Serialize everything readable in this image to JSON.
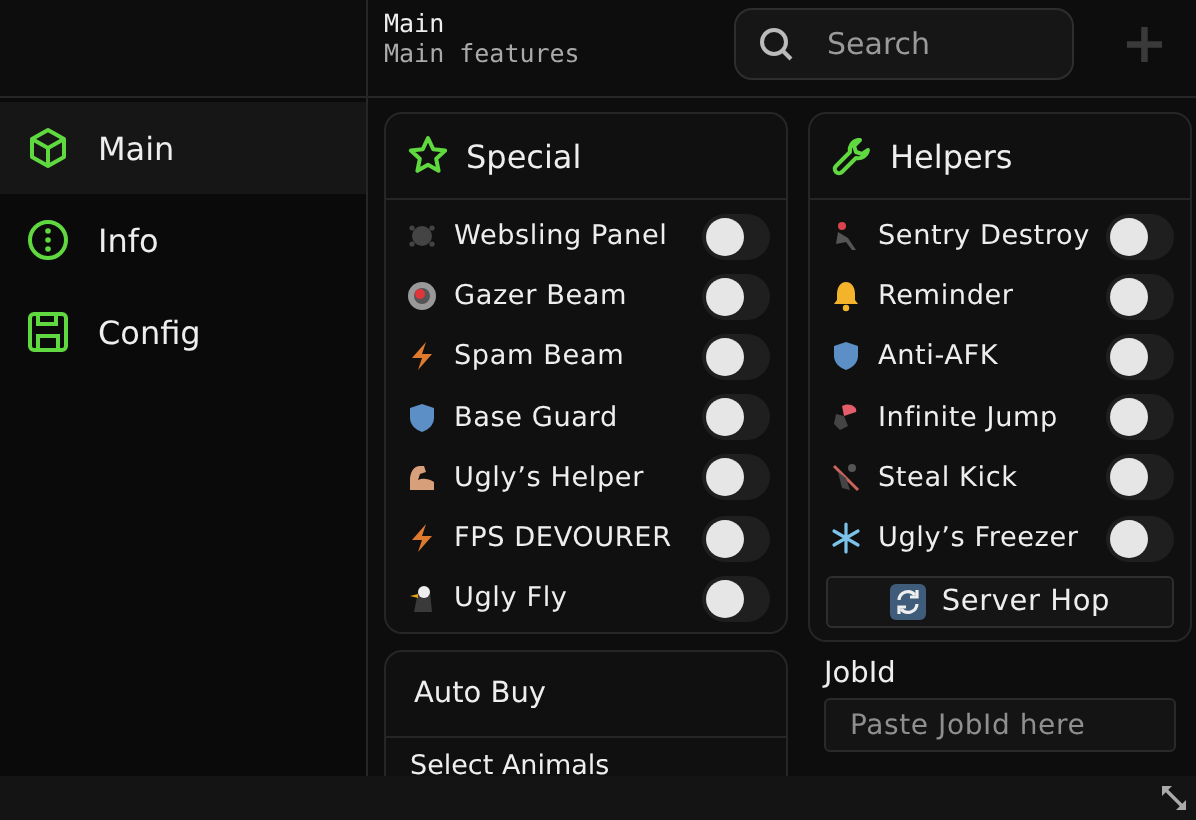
{
  "header": {
    "title": "Main",
    "subtitle": "Main features",
    "search": {
      "placeholder": "Search"
    },
    "add_button": "+"
  },
  "sidebar": {
    "items": [
      {
        "label": "Main",
        "selected": true
      },
      {
        "label": "Info",
        "selected": false
      },
      {
        "label": "Config",
        "selected": false
      }
    ]
  },
  "special": {
    "title": "Special",
    "toggles": [
      {
        "label": "Websling Panel",
        "on": false
      },
      {
        "label": "Gazer Beam",
        "on": false
      },
      {
        "label": "Spam Beam",
        "on": false
      },
      {
        "label": "Base Guard",
        "on": false
      },
      {
        "label": "Ugly’s Helper",
        "on": false
      },
      {
        "label": "FPS DEVOURER",
        "on": false
      },
      {
        "label": "Ugly Fly",
        "on": false
      }
    ]
  },
  "auto_buy": {
    "title": "Auto Buy",
    "select_label": "Select Animals"
  },
  "helpers": {
    "title": "Helpers",
    "toggles": [
      {
        "label": "Sentry Destroy",
        "on": false
      },
      {
        "label": "Reminder",
        "on": false
      },
      {
        "label": "Anti-AFK",
        "on": false
      },
      {
        "label": "Infinite Jump",
        "on": false
      },
      {
        "label": "Steal Kick",
        "on": false
      },
      {
        "label": "Ugly’s Freezer",
        "on": false
      }
    ],
    "button": "Server Hop",
    "jobid_label": "JobId",
    "jobid": {
      "placeholder": "Paste JobId here"
    }
  }
}
